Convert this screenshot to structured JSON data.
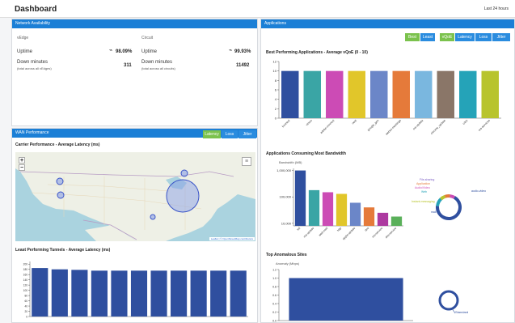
{
  "header": {
    "title": "Dashboard",
    "range": "Last 24 hours"
  },
  "network": {
    "header": "Network Availability",
    "vedge": {
      "label": "vEdge",
      "uptime_label": "Uptime",
      "uptime": "98.09%",
      "down_label": "Down minutes",
      "down_sub": "(total across all vEdges)",
      "down": "311"
    },
    "circuit": {
      "label": "Circuit",
      "uptime_label": "Uptime",
      "uptime": "99.93%",
      "down_label": "Down minutes",
      "down_sub": "(total across all circuits)",
      "down": "11492"
    }
  },
  "wan": {
    "header": "WAN Performance",
    "buttons": [
      "Latency",
      "Loss",
      "Jitter"
    ],
    "map_title": "Carrier Performance - Average Latency (ms)",
    "zoom_in": "+",
    "zoom_out": "−",
    "attribution": "Leaflet | © OpenStreetMap contributors",
    "tunnels_title": "Least Performing Tunnels - Average Latency (ms)"
  },
  "apps": {
    "header": "Applications",
    "filter_buttons": [
      "Best",
      "Least"
    ],
    "metric_buttons": [
      "vQoE",
      "Latency",
      "Loss",
      "Jitter"
    ],
    "best_title": "Best Performing Applications - Average vQoE (0 - 10)",
    "bandwidth_title": "Applications Consuming Most Bandwidth",
    "bandwidth_ylabel": "Bandwidth (MB)",
    "donut_labels": [
      "File-sharing",
      "Application",
      "Audio/Video",
      "Web",
      "Instant-messaging",
      "mail",
      "audio-video"
    ],
    "anomalous_title": "Top Anomalous Sites",
    "anomaly_ylabel": "Anomaly (Mbps)",
    "standard_label": "Standard"
  },
  "chart_data": [
    {
      "type": "bar",
      "title": "Best Performing Applications - Average vQoE (0 - 10)",
      "categories": [
        "konnect",
        "vimeo",
        "adobe-connect",
        "nest",
        "google_gen",
        "webex-meetings",
        "ms-update",
        "chrome_update",
        "citrix",
        "ms-services"
      ],
      "values": [
        10,
        10,
        10,
        10,
        10,
        10,
        10,
        10,
        10,
        10
      ],
      "ylim": [
        0,
        12
      ],
      "yticks": [
        0,
        2,
        4,
        6,
        8,
        10,
        12
      ],
      "colors": [
        "#2f4f9f",
        "#3aa5a5",
        "#cc4bb5",
        "#e1c62a",
        "#6b86c8",
        "#e57a3a",
        "#7ab7df",
        "#8a7668",
        "#25a3b8",
        "#b8c42d"
      ]
    },
    {
      "type": "bar",
      "title": "Applications Consuming Most Bandwidth",
      "ylabel": "Bandwidth (MB)",
      "scale": "log",
      "categories": [
        "ssl",
        "ms-update",
        "web-mail",
        "http",
        "apple-update",
        "dns",
        "ms-service",
        "dns-service"
      ],
      "values": [
        1000000,
        180000,
        150000,
        130000,
        60000,
        40000,
        25000,
        18000
      ],
      "yticks": [
        "1,000,000",
        "100,000",
        "10,000"
      ],
      "colors": [
        "#2f4f9f",
        "#3aa5a5",
        "#cc4bb5",
        "#e1c62a",
        "#6b86c8",
        "#e57a3a",
        "#ad3aa0",
        "#5ab05a"
      ]
    },
    {
      "type": "bar",
      "title": "Least Performing Tunnels - Average Latency (ms)",
      "categories": [
        "1",
        "2",
        "3",
        "4",
        "5",
        "6",
        "7",
        "8",
        "9",
        "10",
        "11"
      ],
      "values": [
        185,
        180,
        178,
        175,
        175,
        175,
        175,
        175,
        175,
        175,
        175
      ],
      "ylim": [
        0,
        210
      ],
      "yticks": [
        0,
        20,
        40,
        60,
        80,
        100,
        120,
        140,
        160,
        180,
        200
      ],
      "colors": [
        "#2f4f9f"
      ]
    },
    {
      "type": "bar",
      "title": "Top Anomalous Sites",
      "ylabel": "Anomaly (Mbps)",
      "categories": [
        "Site"
      ],
      "values": [
        1.0
      ],
      "ylim": [
        0,
        1.2
      ],
      "yticks": [
        "0.0",
        "0.2",
        "0.4",
        "0.6",
        "0.8",
        "1.0",
        "1.2"
      ],
      "colors": [
        "#2f4f9f"
      ]
    }
  ]
}
